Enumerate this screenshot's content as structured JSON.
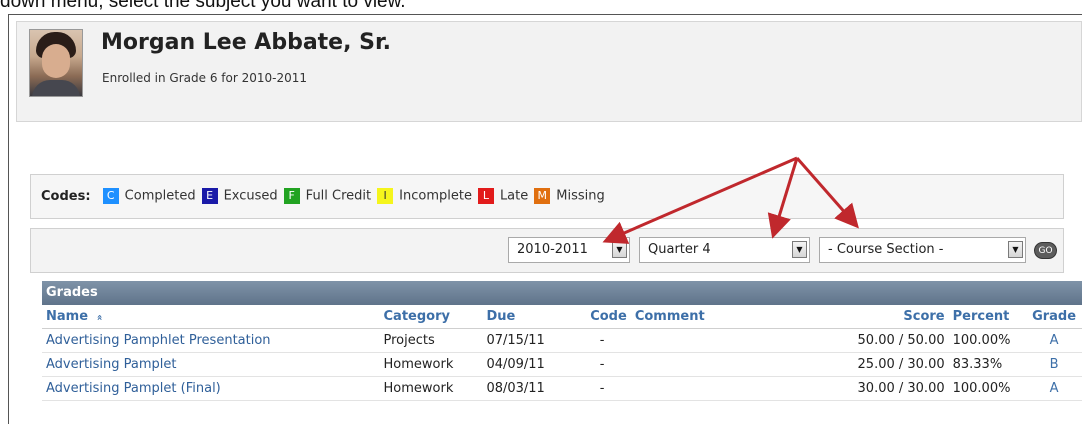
{
  "instruction_text": "down menu, select the subject you want to view.",
  "student": {
    "name": "Morgan Lee Abbate, Sr.",
    "enrollment": "Enrolled in Grade 6 for 2010-2011"
  },
  "codes": {
    "label": "Codes:",
    "items": [
      {
        "letter": "C",
        "label": "Completed",
        "color": "#1e90ff"
      },
      {
        "letter": "E",
        "label": "Excused",
        "color": "#1a1aa8"
      },
      {
        "letter": "F",
        "label": "Full Credit",
        "color": "#22a322"
      },
      {
        "letter": "I",
        "label": "Incomplete",
        "color": "#f5f51c"
      },
      {
        "letter": "L",
        "label": "Late",
        "color": "#e21b1b"
      },
      {
        "letter": "M",
        "label": "Missing",
        "color": "#e06f0f"
      }
    ]
  },
  "filters": {
    "year": "2010-2011",
    "term": "Quarter 4",
    "course": "- Course Section -",
    "go_label": "GO"
  },
  "grades": {
    "section_title": "Grades",
    "columns": {
      "name": "Name",
      "name_sort": "»",
      "category": "Category",
      "due": "Due",
      "code": "Code",
      "comment": "Comment",
      "score": "Score",
      "percent": "Percent",
      "grade": "Grade"
    },
    "rows": [
      {
        "name": "Advertising Pamphlet Presentation",
        "category": "Projects",
        "due": "07/15/11",
        "code": "-",
        "comment": "",
        "score": "50.00 / 50.00",
        "percent": "100.00%",
        "grade": "A"
      },
      {
        "name": "Advertising Pamplet",
        "category": "Homework",
        "due": "04/09/11",
        "code": "-",
        "comment": "",
        "score": "25.00 / 30.00",
        "percent": "83.33%",
        "grade": "B"
      },
      {
        "name": "Advertising Pamplet (Final)",
        "category": "Homework",
        "due": "08/03/11",
        "code": "-",
        "comment": "",
        "score": "30.00 / 30.00",
        "percent": "100.00%",
        "grade": "A"
      }
    ]
  },
  "colors": {
    "annotation_arrow": "#c0282d",
    "link": "#2f5f99",
    "grades_header": "#6f8399"
  }
}
